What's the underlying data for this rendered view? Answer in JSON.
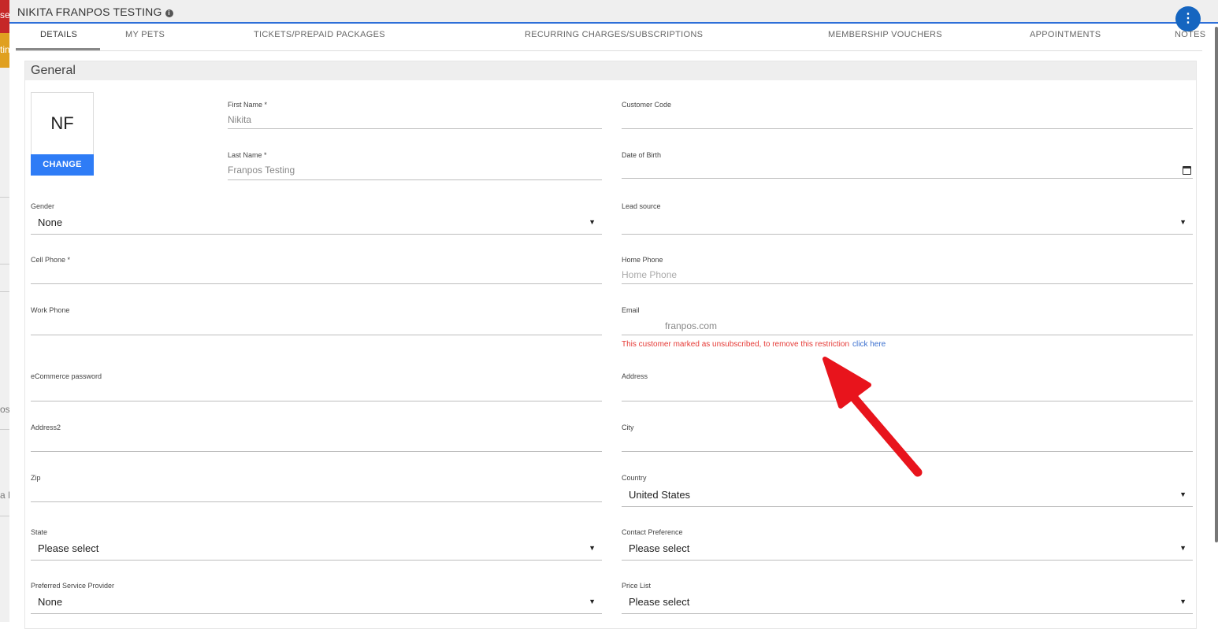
{
  "background_app": {
    "fragments": [
      "se",
      "tin",
      "os",
      "a F"
    ]
  },
  "modal": {
    "title": "NIKITA FRANPOS TESTING",
    "info_icon": "info-icon",
    "menu_icon": "more-vert-icon",
    "menu_glyph": "⋮"
  },
  "tabs": [
    {
      "label": "DETAILS",
      "active": true
    },
    {
      "label": "MY PETS"
    },
    {
      "label": "TICKETS/PREPAID PACKAGES"
    },
    {
      "label": "RECURRING CHARGES/SUBSCRIPTIONS"
    },
    {
      "label": "MEMBERSHIP VOUCHERS"
    },
    {
      "label": "APPOINTMENTS"
    },
    {
      "label": "NOTES"
    }
  ],
  "section": {
    "title": "General"
  },
  "avatar": {
    "initials": "NF",
    "change_label": "CHANGE"
  },
  "fields": {
    "first_name": {
      "label": "First Name *",
      "value": "Nikita"
    },
    "last_name": {
      "label": "Last Name *",
      "value": "Franpos Testing"
    },
    "customer_code": {
      "label": "Customer Code",
      "value": ""
    },
    "date_of_birth": {
      "label": "Date of Birth",
      "value": ""
    },
    "gender": {
      "label": "Gender",
      "value": "None"
    },
    "lead_source": {
      "label": "Lead source",
      "value": ""
    },
    "cell_phone": {
      "label": "Cell Phone *",
      "value": ""
    },
    "home_phone": {
      "label": "Home Phone",
      "placeholder": "Home Phone"
    },
    "work_phone": {
      "label": "Work Phone",
      "value": ""
    },
    "email": {
      "label": "Email",
      "value": "franpos.com"
    },
    "ecommerce_password": {
      "label": "eCommerce password",
      "value": ""
    },
    "address": {
      "label": "Address",
      "value": ""
    },
    "address2": {
      "label": "Address2",
      "value": ""
    },
    "city": {
      "label": "City",
      "value": ""
    },
    "zip": {
      "label": "Zip",
      "value": ""
    },
    "country": {
      "label": "Country",
      "value": "United States"
    },
    "state": {
      "label": "State",
      "value": "Please select"
    },
    "contact_preference": {
      "label": "Contact Preference",
      "value": "Please select"
    },
    "preferred_service_provider": {
      "label": "Preferred Service Provider",
      "value": "None"
    },
    "price_list": {
      "label": "Price List",
      "value": "Please select"
    }
  },
  "unsubscribed_notice": {
    "message": "This customer marked as unsubscribed, to remove this restriction",
    "link": "click here"
  },
  "colors": {
    "accent_blue": "#2e7cf6",
    "menu_blue": "#1565c0",
    "warning_red": "#e53935",
    "annotation_arrow": "#e8141c"
  }
}
